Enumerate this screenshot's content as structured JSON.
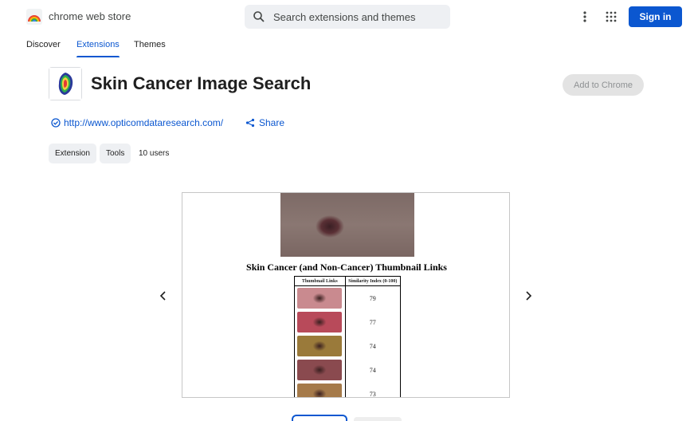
{
  "header": {
    "store_name": "chrome web store",
    "search_placeholder": "Search extensions and themes",
    "signin_label": "Sign in",
    "icons": [
      "rainbow-logo-icon",
      "search-icon",
      "more-vert-icon",
      "apps-grid-icon"
    ]
  },
  "nav": {
    "tabs": [
      {
        "label": "Discover",
        "active": false
      },
      {
        "label": "Extensions",
        "active": true
      },
      {
        "label": "Themes",
        "active": false
      }
    ]
  },
  "item": {
    "title": "Skin Cancer Image Search",
    "add_button": "Add to Chrome",
    "website": "http://www.opticomdataresearch.com/",
    "share_label": "Share",
    "chips": [
      "Extension",
      "Tools"
    ],
    "users": "10 users"
  },
  "screenshot": {
    "heading": "Skin Cancer (and Non-Cancer) Thumbnail Links",
    "col_thumb": "Thumbnail Links",
    "col_index": "Similarity Index (0-100)",
    "rows": [
      {
        "score": "79",
        "color": "#c98a8f"
      },
      {
        "score": "77",
        "color": "#b84a5a"
      },
      {
        "score": "74",
        "color": "#9a7a3a"
      },
      {
        "score": "74",
        "color": "#8a4a4f"
      },
      {
        "score": "73",
        "color": "#a57a4a"
      }
    ]
  },
  "colors": {
    "accent": "#0b57d0",
    "chip_bg": "#eef0f3"
  }
}
